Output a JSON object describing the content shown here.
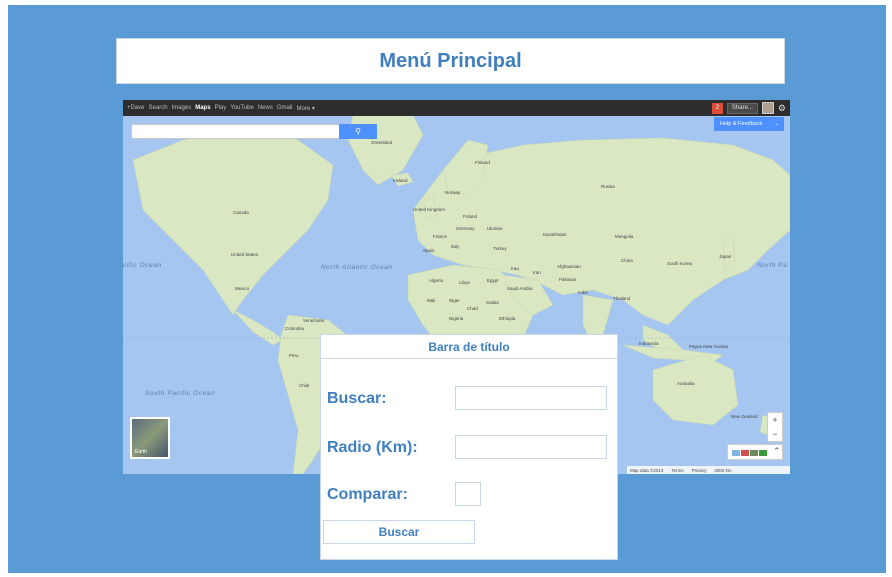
{
  "main_title": "Menú Principal",
  "map": {
    "topbar": {
      "links": [
        "+Dave",
        "Search",
        "Images",
        "Maps",
        "Play",
        "YouTube",
        "News",
        "Gmail",
        "More ▾"
      ],
      "active": "Maps",
      "notifications": "2",
      "share": "Share..."
    },
    "help_feedback": "Help & Feedback",
    "search_icon": "search-icon",
    "oceans": {
      "pacific_w": "cific Ocean",
      "atlantic": "North Atlantic Ocean",
      "pacific_e": "North Pa",
      "south_pacific": "South Pacific Ocean"
    },
    "countries": {
      "greenland": "Greenland",
      "iceland": "Iceland",
      "finland": "Finland",
      "norway": "Norway",
      "russia": "Russia",
      "uk": "United Kingdom",
      "poland": "Poland",
      "germany": "Germany",
      "ukraine": "Ukraine",
      "france": "France",
      "kazakhstan": "Kazakhstan",
      "mongolia": "Mongolia",
      "spain": "Spain",
      "italy": "Italy",
      "turkey": "Turkey",
      "china": "China",
      "japan": "Japan",
      "south_korea": "South Korea",
      "canada": "Canada",
      "united_states": "United States",
      "mexico": "Mexico",
      "algeria": "Algeria",
      "libya": "Libya",
      "egypt": "Egypt",
      "iraq": "Iraq",
      "iran": "Iran",
      "afghanistan": "Afghanistan",
      "pakistan": "Pakistan",
      "india": "India",
      "saudi_arabia": "Saudi Arabia",
      "thailand": "Thailand",
      "mali": "Mali",
      "niger": "Niger",
      "chad": "Chad",
      "sudan": "Sudan",
      "nigeria": "Nigeria",
      "ethiopia": "Ethiopia",
      "venezuela": "Venezuela",
      "colombia": "Colombia",
      "peru": "Peru",
      "chile": "Chile",
      "indonesia": "Indonesia",
      "papua_new_guinea": "Papua New Guinea",
      "australia": "Australia",
      "new_zealand": "New Zealand"
    },
    "earth_label": "Earth",
    "zoom_in": "+",
    "zoom_out": "−",
    "footer": {
      "map_data": "Map data ©2013",
      "terms": "Terms",
      "privacy": "Privacy",
      "scale": "2000 km"
    }
  },
  "dialog": {
    "title": "Barra de título",
    "buscar_label": "Buscar:",
    "buscar_value": "",
    "radio_label": "Radio (Km):",
    "radio_value": "",
    "comparar_label": "Comparar:",
    "submit_label": "Buscar"
  },
  "colors": {
    "background": "#5b9bd5",
    "accent_text": "#3f7fc0",
    "ocean": "#a5c6f0",
    "land": "#d9e7c3"
  }
}
